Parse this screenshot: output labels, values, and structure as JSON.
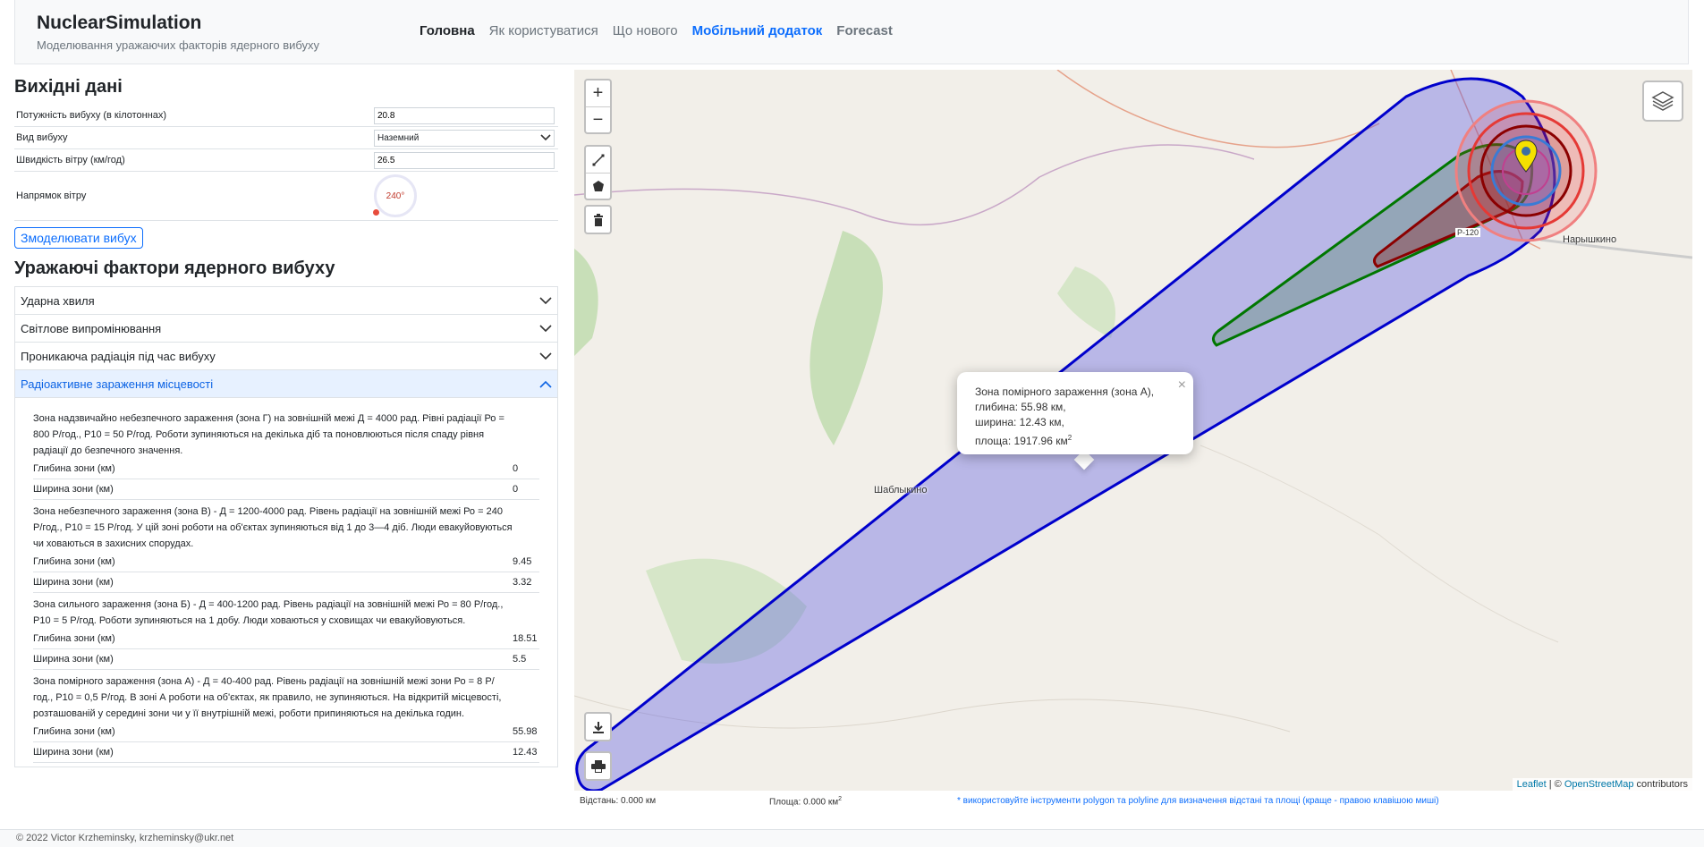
{
  "brand": {
    "title": "NuclearSimulation",
    "subtitle": "Моделювання уражаючих факторів ядерного вибуху"
  },
  "nav": [
    "Головна",
    "Як користуватися",
    "Що нового",
    "Мобільний додаток",
    "Forecast"
  ],
  "input_section": {
    "heading": "Вихідні дані",
    "yield_label": "Потужність вибуху (в кілотоннах)",
    "yield_value": "20.8",
    "type_label": "Вид вибуху",
    "type_value": "Наземний",
    "wind_speed_label": "Швидкість вітру (км/год)",
    "wind_speed_value": "26.5",
    "wind_dir_label": "Напрямок вітру",
    "wind_dir_value": "240°",
    "simulate_button": "Змоделювати вибух"
  },
  "factors": {
    "heading": "Уражаючі фактори ядерного вибуху",
    "items": [
      "Ударна хвиля",
      "Світлове випромінювання",
      "Проникаюча радіація під час вибуху",
      "Радіоактивне зараження місцевості"
    ]
  },
  "zones": [
    {
      "desc": "Зона надзвичайно небезпечного зараження (зона Г) на зовнішній межі Д = 4000 рад. Рівні радіації Ро = 800 Р/год., Р10 = 50 Р/год. Роботи зупиняються на декілька діб та поновлюються після спаду рівня радіації до безпечного значення.",
      "depth_label": "Глибина зони (км)",
      "depth": "0",
      "width_label": "Ширина зони (км)",
      "width": "0"
    },
    {
      "desc": "Зона небезпечного зараження (зона В) - Д = 1200-4000 рад. Рівень радіації на зовнішній межі Ро = 240 Р/год., Р10 = 15 Р/год. У цій зоні роботи на об'єктах зупиняються від 1 до 3—4 діб. Люди евакуйовуються чи ховаються в захисних спорудах.",
      "depth_label": "Глибина зони (км)",
      "depth": "9.45",
      "width_label": "Ширина зони (км)",
      "width": "3.32"
    },
    {
      "desc": "Зона сильного зараження (зона Б) - Д = 400-1200 рад. Рівень радіації на зовнішній межі Ро = 80 Р/год., Р10 = 5 Р/год. Роботи зупиняються на 1 добу. Люди ховаються у сховищах чи евакуйовуються.",
      "depth_label": "Глибина зони (км)",
      "depth": "18.51",
      "width_label": "Ширина зони (км)",
      "width": "5.5"
    },
    {
      "desc": "Зона помірного зараження (зона А) - Д = 40-400 рад. Рівень радіації на зовнішній межі зони Ро = 8 Р/год., Р10 = 0,5 Р/год. В зоні А роботи на об'єктах, як правило, не зупиняються. На відкритій місцевості, розташованій у середині зони чи у її внутрішній межі, роботи припиняються на декілька годин.",
      "depth_label": "Глибина зони (км)",
      "depth": "55.98",
      "width_label": "Ширина зони (км)",
      "width": "12.43"
    }
  ],
  "popup": {
    "line1": "Зона помірного зараження (зона А),",
    "line2": "глибина: 55.98 км,",
    "line3": "ширина: 12.43 км,",
    "line4": "площа: 1917.96 км",
    "sup": "2"
  },
  "map": {
    "town1": "Шаблыкино",
    "town2": "Нарышкино",
    "road": "Р-120",
    "attrib_leaflet": "Leaflet",
    "attrib_sep": " | © ",
    "attrib_osm": "OpenStreetMap",
    "attrib_tail": " contributors",
    "colors": {
      "zoneA": "#0000cc",
      "zoneB": "#007700",
      "zoneV": "#8b0000",
      "shock": "#e53935"
    }
  },
  "measure": {
    "distance": "Відстань: 0.000 км",
    "area": "Площа: 0.000 км",
    "area_sup": "2",
    "hint": "* використовуйте інструменти polygon та polyline для визначення відстані та площі (краще - правою клавішою миші)"
  },
  "footer": "© 2022 Victor Krzheminsky, krzheminsky@ukr.net"
}
